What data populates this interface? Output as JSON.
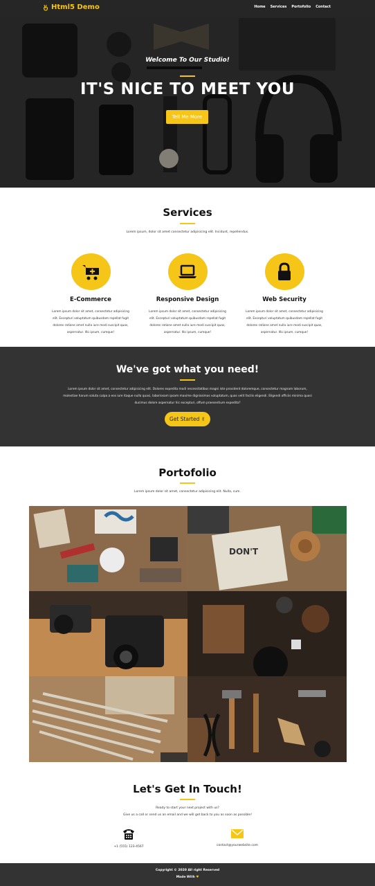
{
  "nav": {
    "brand": "Html5 Demo",
    "links": [
      "Home",
      "Services",
      "Portofolio",
      "Contact"
    ]
  },
  "hero": {
    "subtitle": "Welcome To Our Studio!",
    "title": "IT'S NICE TO MEET YOU",
    "button": "Tell Me More"
  },
  "services": {
    "title": "Services",
    "subtitle": "Lorem ipsum, dolor sit amet consectetur adipisicing elit. Incidunt, repellendus.",
    "items": [
      {
        "name": "E-Commerce",
        "icon": "cart-plus-icon",
        "desc": "Lorem ipsum dolor sit amet, consectetur adipisicing elit. Excepturi voluptatum quibusdam repellat fugit dolores ratione amet nulla iure modi suscipit quas, aspernatur. Illo ipsum, cumque!"
      },
      {
        "name": "Responsive Design",
        "icon": "laptop-icon",
        "desc": "Lorem ipsum dolor sit amet, consectetur adipisicing elit. Excepturi voluptatum quibusdam repellat fugit dolores ratione amet nulla iure modi suscipit quas, aspernatur. Illo ipsum, cumque!"
      },
      {
        "name": "Web Security",
        "icon": "lock-icon",
        "desc": "Lorem ipsum dolor sit amet, consectetur adipisicing elit. Excepturi voluptatum quibusdam repellat fugit dolores ratione amet nulla iure modi suscipit quas, aspernatur. Illo ipsum, cumque!"
      }
    ]
  },
  "promo": {
    "title": "We've got what you need!",
    "text": "Lorem ipsum dolor sit amet, consectetur adipisicing elit. Dolores expedita modi necessitatibus magni iste provident doloremque, consectetur magnam laborum, molestiae harum soluta culpa a eos iure itaque nulla quasi, laboriosam ipsam maxime dignissimos voluptatum, quas velit facilis eligendi. Eligendi officiis minima quasi ducimus dolore aspernatur hic excepturi, offum praesentium expedita?",
    "button": "Get Started"
  },
  "portfolio": {
    "title": "Portofolio",
    "subtitle": "Lorem ipsum dolor sit amet, consectetur adipisicing elit. Nulla, cum."
  },
  "contact": {
    "title": "Let's Get In Touch!",
    "line1": "Ready to start your next project with us?",
    "line2": "Give us a call or send us an email and we will get back to you as soon as possible!",
    "phone": "+1 (555) 123-4567",
    "email": "contact@yourwebsite.com"
  },
  "footer": {
    "copyright": "Copyright © 2020 All right Reserved",
    "made_with": "Made With"
  },
  "colors": {
    "accent": "#f5c518",
    "dark": "#333333",
    "nav": "#262626"
  }
}
